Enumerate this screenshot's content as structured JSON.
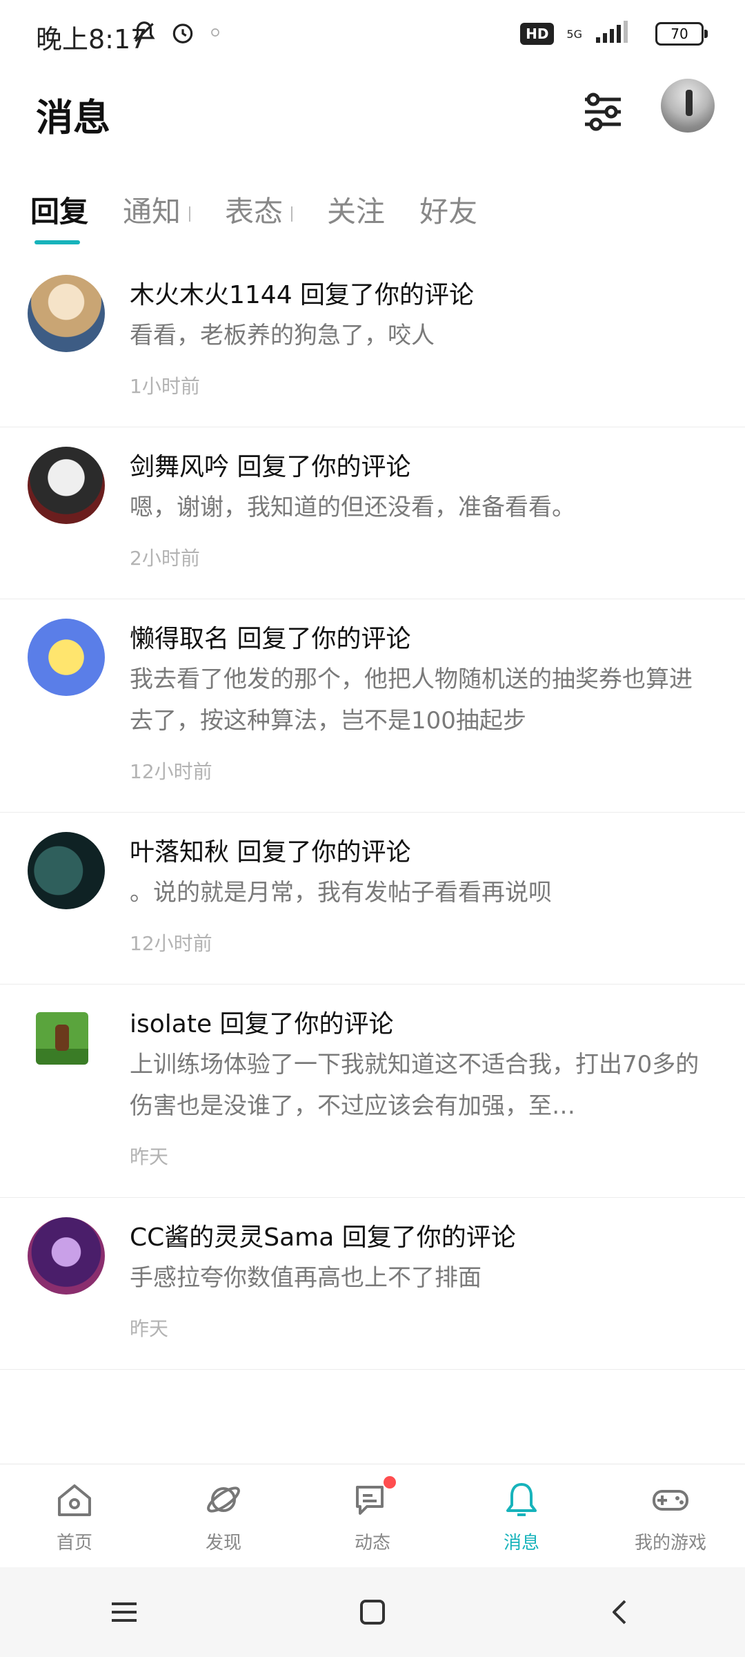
{
  "status_bar": {
    "time": "晚上8:17",
    "network": "5G",
    "hd_label": "HD",
    "battery_level": "70"
  },
  "header": {
    "title": "消息"
  },
  "tabs": [
    {
      "label": "回复",
      "active": true
    },
    {
      "label": "通知"
    },
    {
      "label": "表态"
    },
    {
      "label": "关注"
    },
    {
      "label": "好友"
    }
  ],
  "messages": [
    {
      "title": "木火木火1144 回复了你的评论",
      "text": "看看，老板养的狗急了，咬人",
      "time": "1小时前",
      "avatar": "anime-girl-avatar"
    },
    {
      "title": "剑舞风吟 回复了你的评论",
      "text": "嗯，谢谢，我知道的但还没看，准备看看。",
      "time": "2小时前",
      "avatar": "anime-boy-avatar"
    },
    {
      "title": "懒得取名 回复了你的评论",
      "text": "我去看了他发的那个，他把人物随机送的抽奖券也算进去了，按这种算法，岂不是100抽起步",
      "time": "12小时前",
      "avatar": "cartoon-avatar"
    },
    {
      "title": "叶落知秋 回复了你的评论",
      "text": "。说的就是月常，我有发帖子看看再说呗",
      "time": "12小时前",
      "avatar": "dark-teal-avatar"
    },
    {
      "title": "isolate 回复了你的评论",
      "text": "上训练场体验了一下我就知道这不适合我，打出70多的伤害也是没谁了，不过应该会有加强，至…",
      "time": "昨天",
      "avatar": "pixel-game-avatar"
    },
    {
      "title": "CC酱的灵灵Sama 回复了你的评论",
      "text": "手感拉夸你数值再高也上不了排面",
      "time": "昨天",
      "avatar": "purple-anime-avatar"
    }
  ],
  "bottom_nav": [
    {
      "label": "首页",
      "icon": "home-icon"
    },
    {
      "label": "发现",
      "icon": "planet-icon"
    },
    {
      "label": "动态",
      "icon": "message-icon",
      "badge": true
    },
    {
      "label": "消息",
      "icon": "bell-icon",
      "active": true
    },
    {
      "label": "我的游戏",
      "icon": "gamepad-icon"
    }
  ],
  "colors": {
    "accent": "#17b3bb",
    "badge": "#ff4d4f"
  }
}
